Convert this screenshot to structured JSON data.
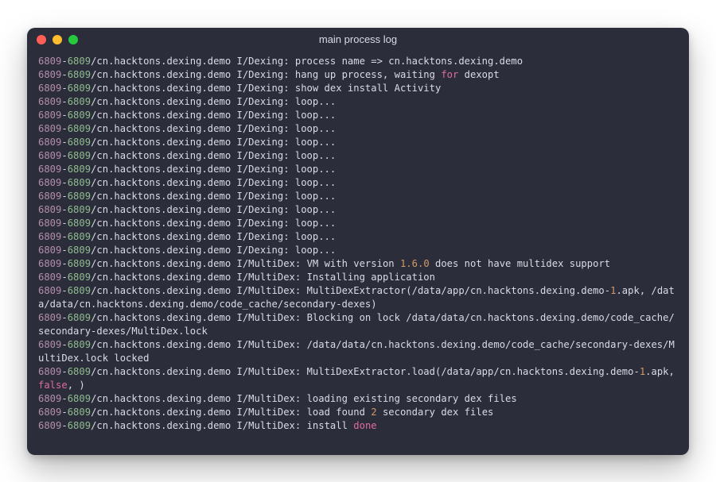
{
  "window": {
    "title": "main process log"
  },
  "colors": {
    "bg": "#2b2d3a",
    "fg": "#d9dbe6",
    "pid1": "#b48ead",
    "pid2": "#8fbc8f",
    "keyword": "#e06c9f",
    "number": "#d19a66"
  },
  "log": {
    "pid1": "6809",
    "pid2": "6809",
    "app": "cn.hacktons.dexing.demo",
    "lines": [
      {
        "tag": "I/Dexing",
        "segs": [
          {
            "t": "process name => cn.hacktons.dexing.demo"
          }
        ]
      },
      {
        "tag": "I/Dexing",
        "segs": [
          {
            "t": "hang up process, waiting "
          },
          {
            "t": "for",
            "cls": "kw"
          },
          {
            "t": " dexopt"
          }
        ]
      },
      {
        "tag": "I/Dexing",
        "segs": [
          {
            "t": "show dex install Activity"
          }
        ]
      },
      {
        "tag": "I/Dexing",
        "segs": [
          {
            "t": "loop..."
          }
        ]
      },
      {
        "tag": "I/Dexing",
        "segs": [
          {
            "t": "loop..."
          }
        ]
      },
      {
        "tag": "I/Dexing",
        "segs": [
          {
            "t": "loop..."
          }
        ]
      },
      {
        "tag": "I/Dexing",
        "segs": [
          {
            "t": "loop..."
          }
        ]
      },
      {
        "tag": "I/Dexing",
        "segs": [
          {
            "t": "loop..."
          }
        ]
      },
      {
        "tag": "I/Dexing",
        "segs": [
          {
            "t": "loop..."
          }
        ]
      },
      {
        "tag": "I/Dexing",
        "segs": [
          {
            "t": "loop..."
          }
        ]
      },
      {
        "tag": "I/Dexing",
        "segs": [
          {
            "t": "loop..."
          }
        ]
      },
      {
        "tag": "I/Dexing",
        "segs": [
          {
            "t": "loop..."
          }
        ]
      },
      {
        "tag": "I/Dexing",
        "segs": [
          {
            "t": "loop..."
          }
        ]
      },
      {
        "tag": "I/Dexing",
        "segs": [
          {
            "t": "loop..."
          }
        ]
      },
      {
        "tag": "I/Dexing",
        "segs": [
          {
            "t": "loop..."
          }
        ]
      },
      {
        "tag": "I/MultiDex",
        "segs": [
          {
            "t": "VM with version "
          },
          {
            "t": "1.6.0",
            "cls": "num"
          },
          {
            "t": " does not have multidex support"
          }
        ]
      },
      {
        "tag": "I/MultiDex",
        "segs": [
          {
            "t": "Installing application"
          }
        ]
      },
      {
        "tag": "I/MultiDex",
        "segs": [
          {
            "t": "MultiDexExtractor(/data/app/cn.hacktons.dexing.demo-"
          },
          {
            "t": "1",
            "cls": "num"
          },
          {
            "t": ".apk, /data/data/cn.hacktons.dexing.demo/code_cache/secondary-dexes)"
          }
        ],
        "wrap": true
      },
      {
        "tag": "I/MultiDex",
        "segs": [
          {
            "t": "Blocking on lock /data/data/cn.hacktons.dexing.demo/code_cache/secondary-dexes/MultiDex.lock"
          }
        ],
        "wrap": true
      },
      {
        "tag": "I/MultiDex",
        "segs": [
          {
            "t": "/data/data/cn.hacktons.dexing.demo/code_cache/secondary-dexes/MultiDex.lock locked"
          }
        ],
        "wrap": true
      },
      {
        "tag": "I/MultiDex",
        "segs": [
          {
            "t": "MultiDexExtractor.load(/data/app/cn.hacktons.dexing.demo-"
          },
          {
            "t": "1",
            "cls": "num"
          },
          {
            "t": ".apk, "
          },
          {
            "t": "false",
            "cls": "kw"
          },
          {
            "t": ", )"
          }
        ],
        "wrap": true
      },
      {
        "tag": "I/MultiDex",
        "segs": [
          {
            "t": "loading existing secondary dex files"
          }
        ]
      },
      {
        "tag": "I/MultiDex",
        "segs": [
          {
            "t": "load found "
          },
          {
            "t": "2",
            "cls": "num"
          },
          {
            "t": " secondary dex files"
          }
        ]
      },
      {
        "tag": "I/MultiDex",
        "segs": [
          {
            "t": "install "
          },
          {
            "t": "done",
            "cls": "kw"
          }
        ]
      }
    ]
  }
}
